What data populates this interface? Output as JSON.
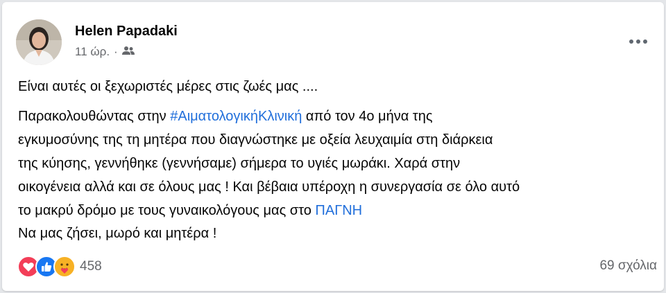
{
  "post": {
    "author": "Helen Papadaki",
    "time": "11 ώρ.",
    "separator": "·",
    "audience_icon": "friends-icon",
    "more_icon": "more-horizontal-icon"
  },
  "body": {
    "line1": "Είναι αυτές οι ξεχωριστές μέρες στις ζωές μας ....",
    "line2_pre": "Παρακολουθώντας στην ",
    "hashtag": "#ΑιματολογικήΚλινική",
    "line2_post": " από τον 4ο μήνα της",
    "line3": "εγκυμοσύνης της τη μητέρα που διαγνώστηκε με οξεία λευχαιμία στη διάρκεια",
    "line4": "της κύησης, γεννήθηκε (γεννήσαμε) σήμερα το υγιές μωράκι. Χαρά στην",
    "line5": "οικογένεια αλλά και σε όλους μας ! Και βέβαια υπέροχη η συνεργασία σε όλο αυτό",
    "line6_pre": "το μακρύ δρόμο με τους γυναικολόγους μας στο ",
    "mention": "ΠΑΓΝΗ",
    "line7": "Να μας ζήσει, μωρό και μητέρα !"
  },
  "footer": {
    "reaction_icons": [
      "love-reaction-icon",
      "like-reaction-icon",
      "care-reaction-icon"
    ],
    "reaction_count": "458",
    "comments": "69 σχόλια"
  },
  "colors": {
    "link": "#216fdb",
    "secondary_text": "#65676b",
    "love": "#f33e58",
    "like": "#1877f2",
    "care": "#f7b125"
  }
}
